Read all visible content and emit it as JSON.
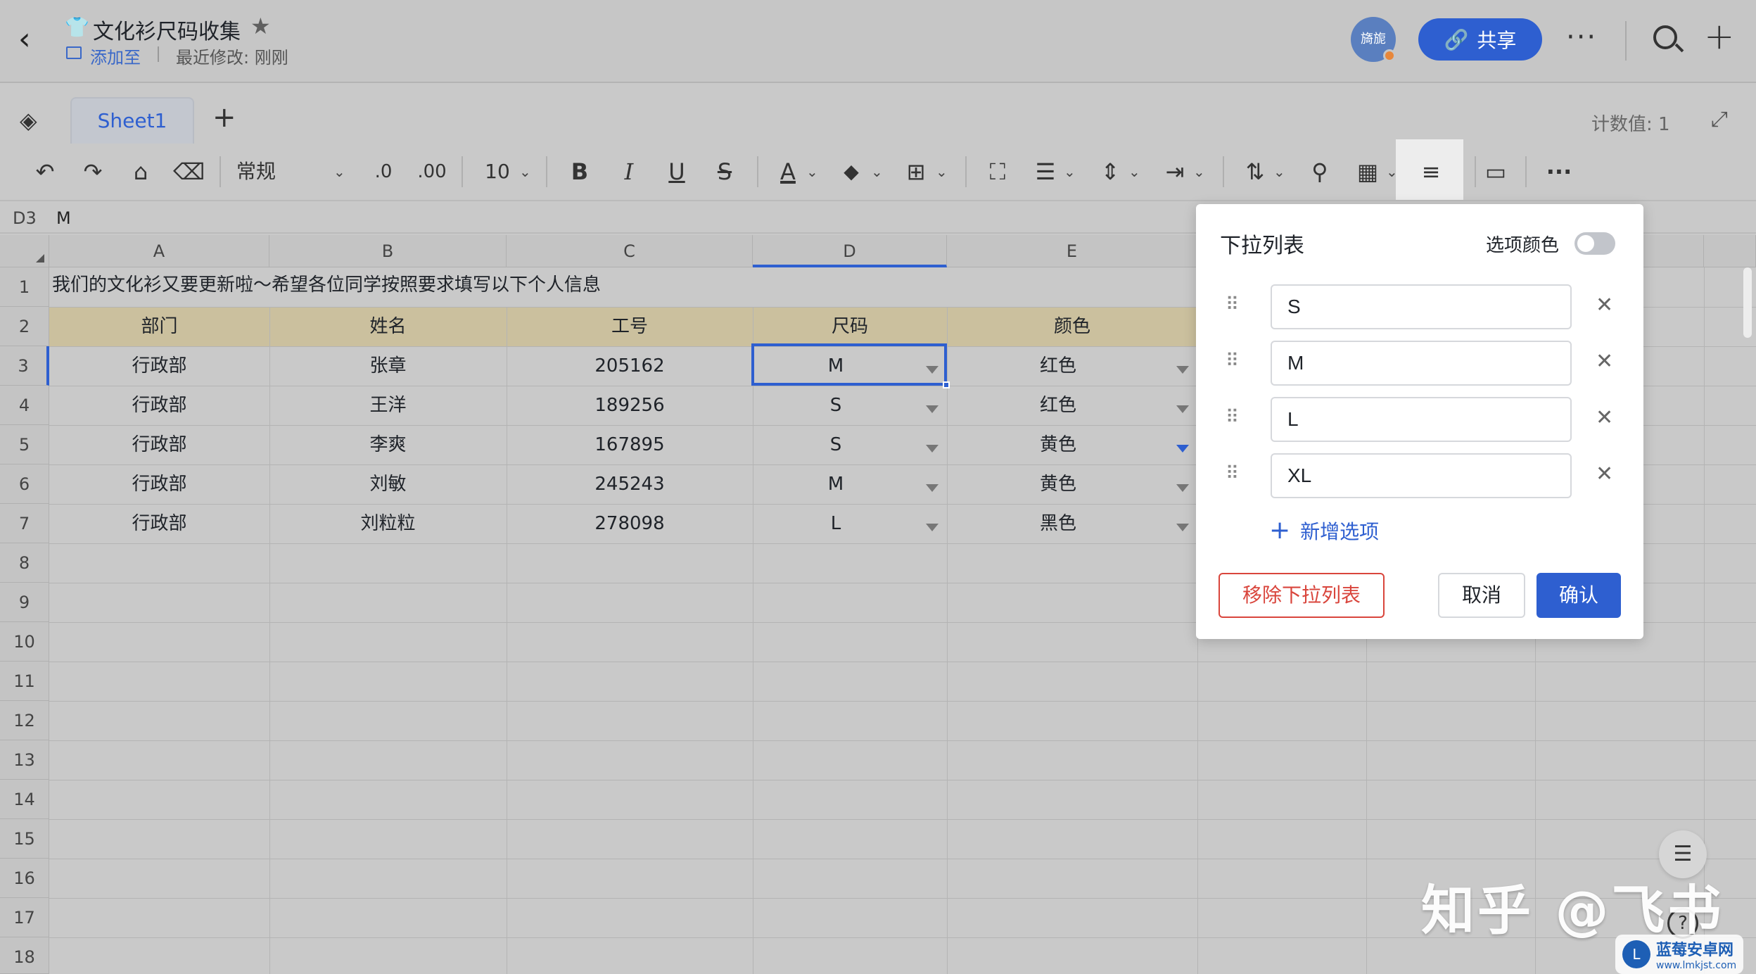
{
  "header": {
    "back_icon": "‹",
    "doc_icon": "👕",
    "title": "文化衫尺码收集",
    "star_icon": "★",
    "add_to_label": "添加至",
    "last_modified": "最近修改: 刚刚",
    "avatar_text": "旖旎",
    "share_icon": "🔗",
    "share_label": "共享",
    "more_label": "···",
    "plus_label": "+"
  },
  "tabs": {
    "layers_icon": "◈",
    "sheets": [
      "Sheet1"
    ],
    "add_sheet_label": "+",
    "count_label": "计数值: 1",
    "expand_icon": "⤢"
  },
  "toolbar": {
    "undo_icon": "↶",
    "redo_icon": "↷",
    "format_painter_icon": "⌂",
    "eraser_icon": "⌫",
    "number_format": "常规",
    "decrease_decimal": ".0",
    "increase_decimal": ".00",
    "font_size": "10",
    "bold": "B",
    "italic": "I",
    "underline": "U",
    "strike": "S",
    "font_color": "A",
    "fill_icon": "◆",
    "border_icon": "⊞",
    "merge_icon": "⛶",
    "align_icon": "☰",
    "valign_icon": "⇕",
    "wrap_icon": "⇥",
    "sort_icon": "⇅",
    "filter_icon": "⚲",
    "chart_icon": "▦",
    "dropdown_icon": "≡",
    "comment_icon": "▭",
    "more_icon": "···"
  },
  "formula": {
    "cell_ref": "D3",
    "value": "M"
  },
  "sheet": {
    "columns": [
      "A",
      "B",
      "C",
      "D",
      "E"
    ],
    "rows": [
      "1",
      "2",
      "3",
      "4",
      "5",
      "6",
      "7",
      "8",
      "9",
      "10",
      "11",
      "12",
      "13",
      "14",
      "15",
      "16",
      "17",
      "18"
    ],
    "row1": "我们的文化衫又要更新啦～希望各位同学按照要求填写以下个人信息",
    "headers": [
      "部门",
      "姓名",
      "工号",
      "尺码",
      "颜色"
    ],
    "data": [
      [
        "行政部",
        "张章",
        "205162",
        "M",
        "红色"
      ],
      [
        "行政部",
        "王洋",
        "189256",
        "S",
        "红色"
      ],
      [
        "行政部",
        "李爽",
        "167895",
        "S",
        "黄色"
      ],
      [
        "行政部",
        "刘敏",
        "245243",
        "M",
        "黄色"
      ],
      [
        "行政部",
        "刘粒粒",
        "278098",
        "L",
        "黑色"
      ]
    ]
  },
  "panel": {
    "title": "下拉列表",
    "option_color_label": "选项颜色",
    "option_color_enabled": false,
    "options": [
      "S",
      "M",
      "L",
      "XL"
    ],
    "drag_icon": "⠿",
    "remove_icon": "✕",
    "add_option_label": "新增选项",
    "remove_list_label": "移除下拉列表",
    "cancel_label": "取消",
    "confirm_label": "确认"
  },
  "floating": {
    "doc_icon": "☰",
    "help_icon": "?"
  },
  "watermarks": {
    "zhihu": "知乎 @飞书",
    "site_name": "蓝莓安卓网",
    "site_url": "www.lmkjst.com",
    "site_logo": "L"
  },
  "colors": {
    "accent": "#2e5fd0",
    "header_row": "#cbc09e",
    "danger": "#d9453c"
  }
}
